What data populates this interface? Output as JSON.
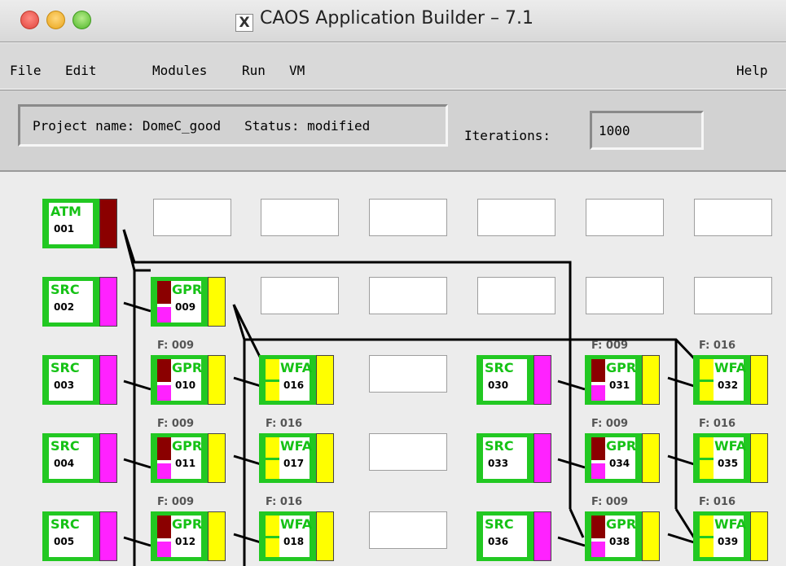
{
  "window": {
    "title": "CAOS Application Builder – 7.1",
    "x_icon": "X"
  },
  "menu": {
    "file": "File",
    "edit": "Edit",
    "modules": "Modules",
    "run": "Run",
    "vm": "VM",
    "help": "Help"
  },
  "project": {
    "label": "Project name: DomeC_good   Status: modified",
    "iterations_label": "Iterations:",
    "iterations_value": "1000"
  },
  "colors": {
    "module_green": "#22c822",
    "input_red": "#8b0000",
    "magenta": "#ff22ff",
    "yellow": "#ffff00"
  },
  "modules": {
    "m001": {
      "name": "ATM",
      "num": "001"
    },
    "m002": {
      "name": "SRC",
      "num": "002"
    },
    "m003": {
      "name": "SRC",
      "num": "003"
    },
    "m004": {
      "name": "SRC",
      "num": "004"
    },
    "m005": {
      "name": "SRC",
      "num": "005"
    },
    "m009": {
      "name": "GPR",
      "num": "009"
    },
    "m010": {
      "name": "GPR",
      "num": "010",
      "feedback": "F: 009"
    },
    "m011": {
      "name": "GPR",
      "num": "011",
      "feedback": "F: 009"
    },
    "m012": {
      "name": "GPR",
      "num": "012",
      "feedback": "F: 009"
    },
    "m016": {
      "name": "WFA",
      "num": "016"
    },
    "m017": {
      "name": "WFA",
      "num": "017",
      "feedback": "F: 016"
    },
    "m018": {
      "name": "WFA",
      "num": "018",
      "feedback": "F: 016"
    },
    "m030": {
      "name": "SRC",
      "num": "030"
    },
    "m033": {
      "name": "SRC",
      "num": "033"
    },
    "m036": {
      "name": "SRC",
      "num": "036"
    },
    "m031": {
      "name": "GPR",
      "num": "031",
      "feedback": "F: 009"
    },
    "m034": {
      "name": "GPR",
      "num": "034",
      "feedback": "F: 009"
    },
    "m038": {
      "name": "GPR",
      "num": "038",
      "feedback": "F: 009"
    },
    "m032": {
      "name": "WFA",
      "num": "032",
      "feedback": "F: 016"
    },
    "m035": {
      "name": "WFA",
      "num": "035",
      "feedback": "F: 016"
    },
    "m039": {
      "name": "WFA",
      "num": "039",
      "feedback": "F: 016"
    }
  }
}
